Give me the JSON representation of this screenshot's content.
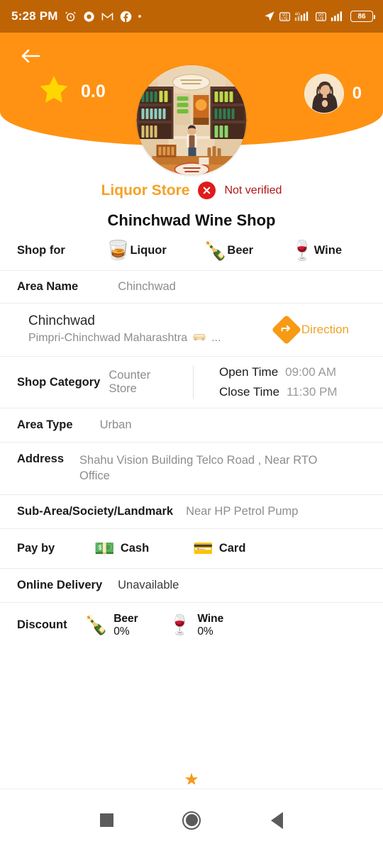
{
  "status_bar": {
    "time": "5:28 PM",
    "battery_level": "86",
    "left_icons": [
      "alarm-icon",
      "record-icon",
      "gmail-icon",
      "facebook-icon",
      "more-dot-icon"
    ],
    "right_icons": [
      "location-arrow-icon",
      "volte-icon",
      "signal-4g-icon",
      "volte-2-icon",
      "signal-2-icon",
      "battery-icon"
    ]
  },
  "header": {
    "back_icon": "back-arrow-icon",
    "star_icon": "star-icon",
    "rating": "0.0",
    "avatar_icon": "user-avatar",
    "viewer_count": "0",
    "store_image": "liquor-store-interior"
  },
  "store": {
    "type": "Liquor Store",
    "verified_icon": "x-circle-icon",
    "verified_text": "Not verified",
    "name": "Chinchwad Wine Shop"
  },
  "shop_for": {
    "label": "Shop for",
    "items": [
      {
        "label": "Liquor",
        "icon": "liquor-bottle-icon",
        "glyph": "🥃"
      },
      {
        "label": "Beer",
        "icon": "beer-bottle-icon",
        "glyph": "🍾"
      },
      {
        "label": "Wine",
        "icon": "wine-icon",
        "glyph": "🍷"
      }
    ]
  },
  "area_name": {
    "label": "Area Name",
    "value": "Chinchwad"
  },
  "location": {
    "city": "Chinchwad",
    "region": "Pimpri-Chinchwad Maharashtra",
    "car_icon": "car-icon",
    "ellipsis": "...",
    "direction_label": "Direction",
    "direction_icon": "direction-sign-icon"
  },
  "shop_category": {
    "label": "Shop Category",
    "value": "Counter Store"
  },
  "timings": {
    "open_label": "Open Time",
    "open_value": "09:00 AM",
    "close_label": "Close Time",
    "close_value": "11:30 PM"
  },
  "area_type": {
    "label": "Area Type",
    "value": "Urban"
  },
  "address": {
    "label": "Address",
    "value": "Shahu Vision Building Telco Road , Near RTO Office"
  },
  "landmark": {
    "label": "Sub-Area/Society/Landmark",
    "value": "Near HP Petrol Pump"
  },
  "pay_by": {
    "label": "Pay by",
    "items": [
      {
        "label": "Cash",
        "icon": "cash-icon",
        "glyph": "💵"
      },
      {
        "label": "Card",
        "icon": "card-icon",
        "glyph": "💳"
      }
    ]
  },
  "online_delivery": {
    "label": "Online Delivery",
    "value": "Unavailable"
  },
  "discount": {
    "label": "Discount",
    "items": [
      {
        "name": "Beer",
        "percent": "0%",
        "icon": "beer-bottle-icon",
        "glyph": "🍾"
      },
      {
        "name": "Wine",
        "percent": "0%",
        "icon": "wine-icon",
        "glyph": "🍷"
      }
    ]
  },
  "footer": {
    "star_icon": "star-icon",
    "star_glyph": "★"
  },
  "nav_bar": {
    "recents_icon": "recents-square-icon",
    "home_icon": "home-circle-icon",
    "back_icon": "back-triangle-icon"
  },
  "colors": {
    "status_bar": "#bf6405",
    "header_orange": "#ff9212",
    "accent_orange": "#f6a124",
    "verify_red": "#e01b1b",
    "muted_text": "#8d8d8d"
  }
}
